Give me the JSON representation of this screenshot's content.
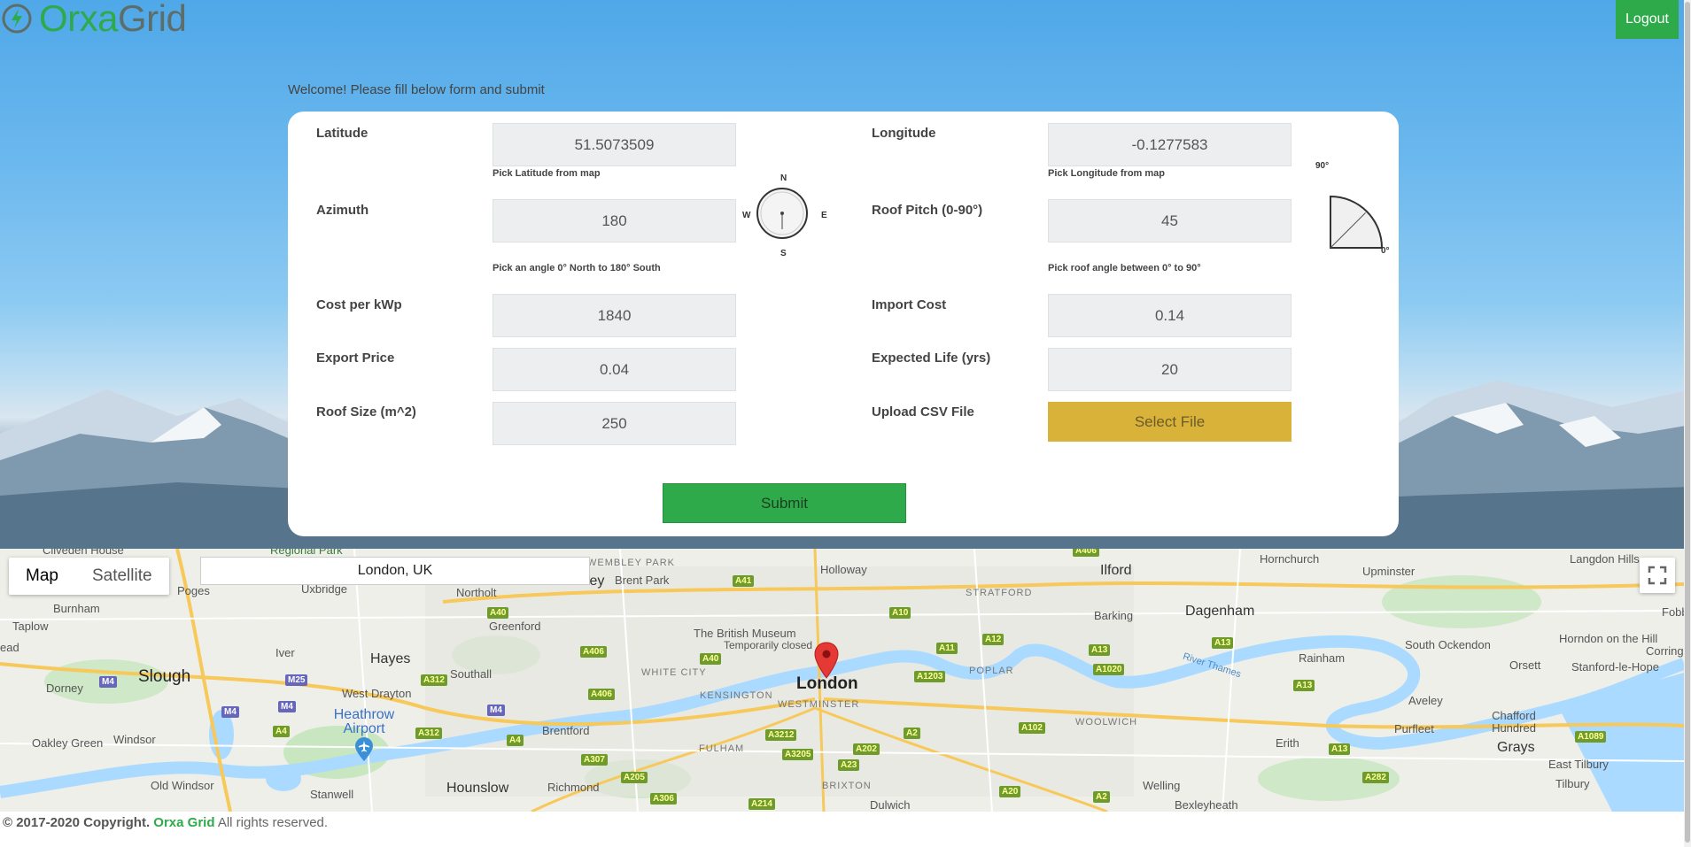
{
  "header": {
    "logo_part1": "Orxa",
    "logo_part2": "Grid",
    "logout_label": "Logout"
  },
  "welcome": "Welcome! Please fill below form and submit",
  "form": {
    "latitude": {
      "label": "Latitude",
      "value": "51.5073509",
      "hint": "Pick Latitude from map"
    },
    "longitude": {
      "label": "Longitude",
      "value": "-0.1277583",
      "hint": "Pick Longitude from map"
    },
    "azimuth": {
      "label": "Azimuth",
      "value": "180",
      "hint": "Pick an angle 0° North to 180° South"
    },
    "roof_pitch": {
      "label": "Roof Pitch (0-90°)",
      "value": "45",
      "hint": "Pick roof angle between 0° to 90°"
    },
    "cost_per_kwp": {
      "label": "Cost per kWp",
      "value": "1840"
    },
    "import_cost": {
      "label": "Import Cost",
      "value": "0.14"
    },
    "export_price": {
      "label": "Export Price",
      "value": "0.04"
    },
    "expected_life": {
      "label": "Expected Life (yrs)",
      "value": "20"
    },
    "roof_size": {
      "label": "Roof Size (m^2)",
      "value": "250"
    },
    "upload_csv": {
      "label": "Upload CSV File",
      "button": "Select File"
    },
    "submit_label": "Submit"
  },
  "compass": {
    "n": "N",
    "s": "S",
    "e": "E",
    "w": "W",
    "angle_deg": 180
  },
  "pitch_dial": {
    "max_label": "90°",
    "min_label": "0°",
    "angle_deg": 45
  },
  "map": {
    "type_map": "Map",
    "type_satellite": "Satellite",
    "search_value": "London, UK",
    "labels": {
      "cliveden": "Cliveden House",
      "regional_park": "Regional Park",
      "wembley_park": "WEMBLEY PARK",
      "wembley": "Wembley",
      "brent_park": "Brent Park",
      "holloway": "Holloway",
      "hornchurch": "Hornchurch",
      "langdon_hills": "Langdon Hills",
      "poges": "Poges",
      "uxbridge": "Uxbridge",
      "northolt": "Northolt",
      "ilford": "Ilford",
      "upminster": "Upminster",
      "burnham": "Burnham",
      "greenford": "Greenford",
      "stratford": "STRATFORD",
      "dagenham": "Dagenham",
      "taplow": "Taplow",
      "british_museum": "The British Museum",
      "temporarily_closed": "Temporarily closed",
      "barking": "Barking",
      "head": "ead",
      "iver": "Iver",
      "hayes": "Hayes",
      "south_ockendon": "South Ockendon",
      "horndon": "Horndon on the Hill",
      "slough": "Slough",
      "southall": "Southall",
      "white_city": "WHITE CITY",
      "rainham": "Rainham",
      "orsett": "Orsett",
      "corringham": "Corringhar",
      "stanford": "Stanford-le-Hope",
      "dorney": "Dorney",
      "west_drayton": "West Drayton",
      "kensington": "KENSINGTON",
      "london": "London",
      "poplar": "POPLAR",
      "river_thames": "River Thames",
      "fobbing": "Fobbi",
      "heathrow": "Heathrow Airport",
      "westminster": "WESTMINSTER",
      "aveley": "Aveley",
      "chafford": "Chafford Hundred",
      "oakley_green": "Oakley Green",
      "windsor": "Windsor",
      "brentford": "Brentford",
      "woolwich": "WOOLWICH",
      "fulham": "FULHAM",
      "erith": "Erith",
      "purfleet": "Purfleet",
      "grays": "Grays",
      "old_windsor": "Old Windsor",
      "hounslow": "Hounslow",
      "richmond": "Richmond",
      "east_tilbury": "East Tilbury",
      "tilbury": "Tilbury",
      "welling": "Welling",
      "stanwell": "Stanwell",
      "brixton": "BRIXTON",
      "dulwich": "Dulwich",
      "bexleyheath": "Bexleyheath"
    },
    "roads": {
      "a406a": "A406",
      "a41": "A41",
      "a40": "A40",
      "a10": "A10",
      "a406b": "A406",
      "a11": "A11",
      "a12": "A12",
      "a13a": "A13",
      "a13b": "A13",
      "a1020": "A1020",
      "m4a": "M4",
      "m25": "M25",
      "a312a": "A312",
      "a40b": "A40",
      "a406c": "A406",
      "a1203": "A1203",
      "a13c": "A13",
      "m4b": "M4",
      "m4c": "M4",
      "m4d": "M4",
      "a4a": "A4",
      "a4b": "A4",
      "a312b": "A312",
      "a3212": "A3212",
      "a2a": "A2",
      "a102": "A102",
      "a202": "A202",
      "a13d": "A13",
      "a307": "A307",
      "a3205": "A3205",
      "a23": "A23",
      "a205": "A205",
      "a282": "A282",
      "a1089": "A1089",
      "a306": "A306",
      "a214": "A214",
      "a20": "A20",
      "a2b": "A2"
    }
  },
  "footer": {
    "copyright": "© 2017-2020 Copyright.",
    "brand": "Orxa Grid",
    "rights": "All rights reserved."
  },
  "colors": {
    "brand_green": "#2eaa4a",
    "select_file_yellow": "#d9b23a",
    "field_bg": "#eceeef"
  }
}
